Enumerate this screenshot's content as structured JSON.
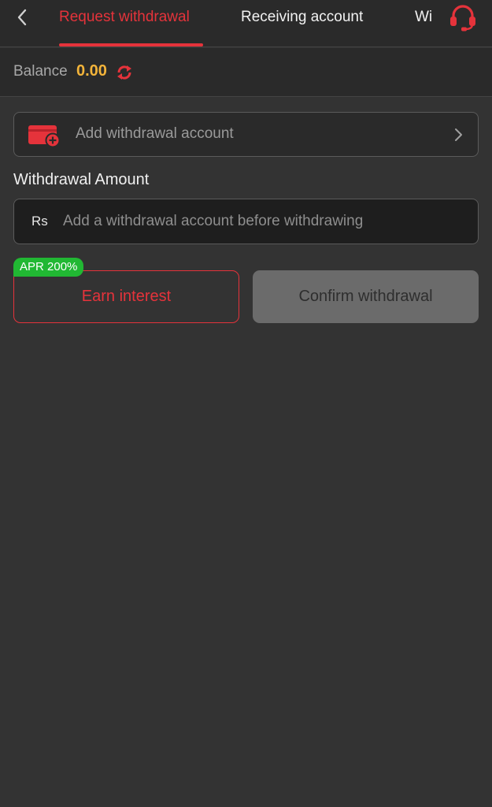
{
  "header": {
    "tabs": [
      {
        "label": "Request withdrawal",
        "active": true
      },
      {
        "label": "Receiving account",
        "active": false
      },
      {
        "label": "Wi",
        "active": false
      }
    ],
    "back_icon": "chevron-left-icon",
    "support_icon": "headset-icon"
  },
  "balance": {
    "label": "Balance",
    "value": "0.00",
    "refresh_icon": "refresh-icon"
  },
  "account": {
    "placeholder": "Add withdrawal account",
    "icon": "wallet-add-icon"
  },
  "amount": {
    "label": "Withdrawal Amount",
    "currency": "Rs",
    "placeholder": "Add a withdrawal account before withdrawing",
    "value": ""
  },
  "actions": {
    "earn_label": "Earn interest",
    "apr_badge": "APR 200%",
    "confirm_label": "Confirm withdrawal"
  },
  "colors": {
    "accent": "#e5333b",
    "balance_value": "#f3b43a",
    "badge": "#21b833",
    "background": "#333333"
  }
}
